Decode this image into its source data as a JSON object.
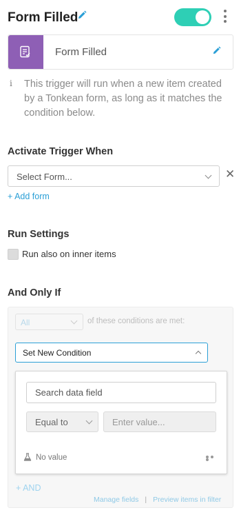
{
  "header": {
    "title": "Form Filled",
    "toggle_on": true,
    "toggle_color": "#2ecfb5"
  },
  "trigger_card": {
    "name": "Form Filled",
    "icon": "form-icon",
    "icon_color": "#8e5fb5"
  },
  "info": {
    "icon": "info-icon",
    "text": "This trigger will run when a new item created by a Tonkean form, as long as it matches the condition below."
  },
  "activate": {
    "title": "Activate Trigger When",
    "select_value": "Select Form...",
    "clear_icon": "close-icon",
    "add_form": "+ Add form"
  },
  "run_settings": {
    "title": "Run Settings",
    "checkbox_label": "Run also on inner items",
    "checked": false
  },
  "and_only_if": {
    "title": "And Only If",
    "match_select": "All",
    "match_suffix": "of these conditions are met:",
    "condition_select": "Set New Condition",
    "dropdown": {
      "search_placeholder": "Search data field",
      "operator": "Equal to",
      "value_placeholder": "Enter value...",
      "no_value": "No value"
    },
    "add_and": "+ AND",
    "manage_fields": "Manage fields",
    "separator": "|",
    "preview_items": "Preview items in filter"
  },
  "colors": {
    "accent_blue": "#2a9fd6",
    "toggle_teal": "#2ecfb5",
    "form_purple": "#8e5fb5"
  }
}
